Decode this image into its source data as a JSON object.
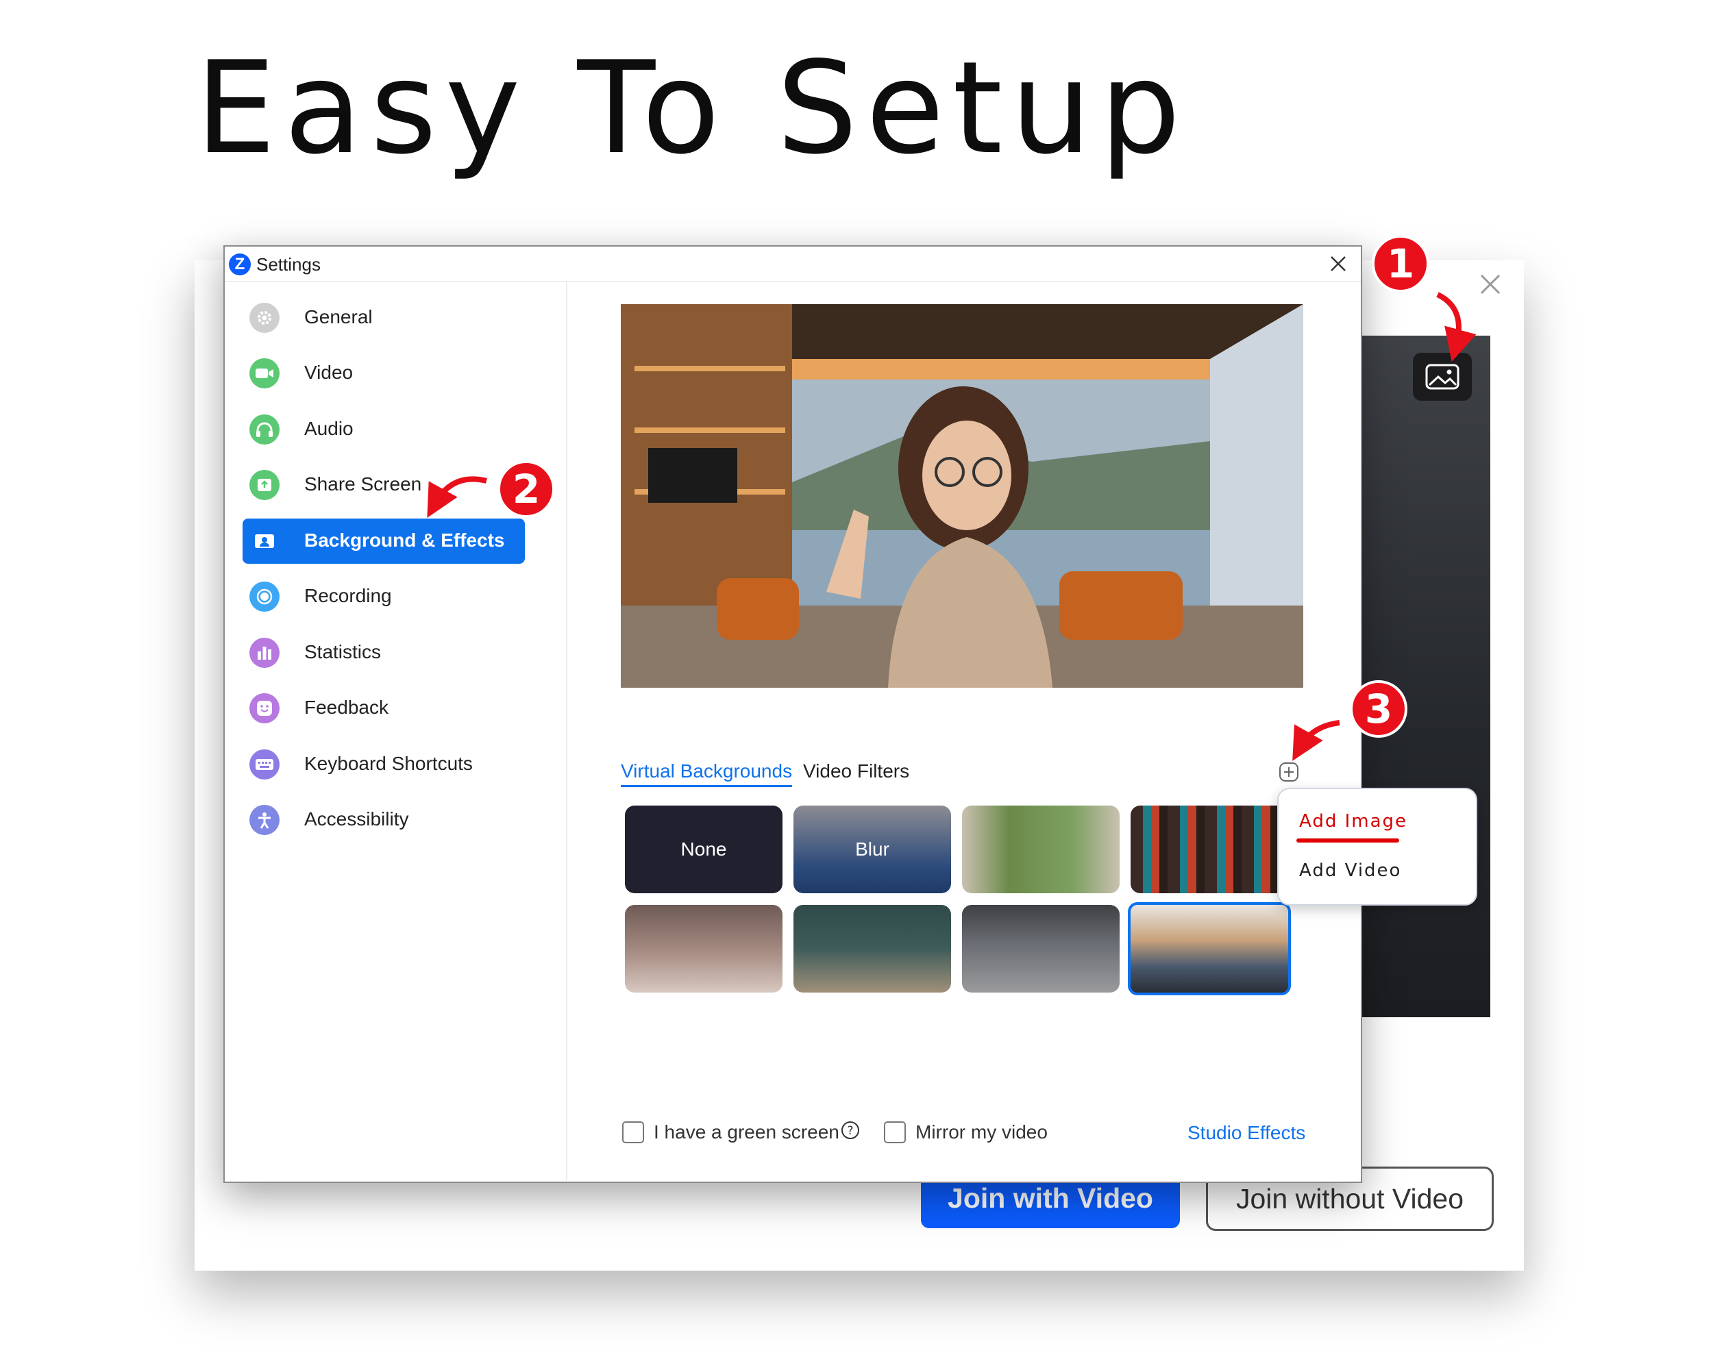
{
  "headline": "Easy To Setup",
  "back_window": {
    "join_with_video": "Join with Video",
    "join_without_video": "Join without Video",
    "background_button_icon": "image-icon",
    "close_icon": "close-icon"
  },
  "settings": {
    "title": "Settings",
    "app_logo": "Z",
    "nav_items": [
      {
        "label": "General",
        "icon": "gear-icon",
        "color": "#c9c9c9"
      },
      {
        "label": "Video",
        "icon": "video-camera-icon",
        "color": "#5bc874"
      },
      {
        "label": "Audio",
        "icon": "headphones-icon",
        "color": "#5bc874"
      },
      {
        "label": "Share Screen",
        "icon": "share-screen-icon",
        "color": "#5bc874"
      },
      {
        "label": "Background & Effects",
        "icon": "person-card-icon",
        "color": "#0e72ed",
        "active": true
      },
      {
        "label": "Recording",
        "icon": "record-icon",
        "color": "#3da7f5"
      },
      {
        "label": "Statistics",
        "icon": "bar-chart-icon",
        "color": "#b778e0"
      },
      {
        "label": "Feedback",
        "icon": "smiley-icon",
        "color": "#b778e0"
      },
      {
        "label": "Keyboard Shortcuts",
        "icon": "keyboard-icon",
        "color": "#8e7be6"
      },
      {
        "label": "Accessibility",
        "icon": "accessibility-icon",
        "color": "#8088e6"
      }
    ],
    "tabs": {
      "virtual_backgrounds": "Virtual Backgrounds",
      "video_filters": "Video Filters"
    },
    "thumbnails": [
      {
        "label": "None",
        "color": "#20202e"
      },
      {
        "label": "Blur",
        "color": "#2c4a7a"
      },
      {
        "label": "",
        "color": "#6b8a4a"
      },
      {
        "label": "",
        "color": "#3a2a26"
      },
      {
        "label": "",
        "color": "#8a6e66"
      },
      {
        "label": "",
        "color": "#3f5c5a"
      },
      {
        "label": "",
        "color": "#6b6e74"
      },
      {
        "label": "",
        "color": "#4a5a70",
        "selected": true
      }
    ],
    "add_menu": {
      "add_image": "Add Image",
      "add_video": "Add Video"
    },
    "green_screen": "I have a green screen",
    "mirror_video": "Mirror my video",
    "studio_effects": "Studio Effects"
  },
  "steps": [
    "1",
    "2",
    "3"
  ],
  "colors": {
    "accent": "#0e72ed",
    "join_blue": "#0b5cff",
    "step_red": "#e8101b"
  }
}
